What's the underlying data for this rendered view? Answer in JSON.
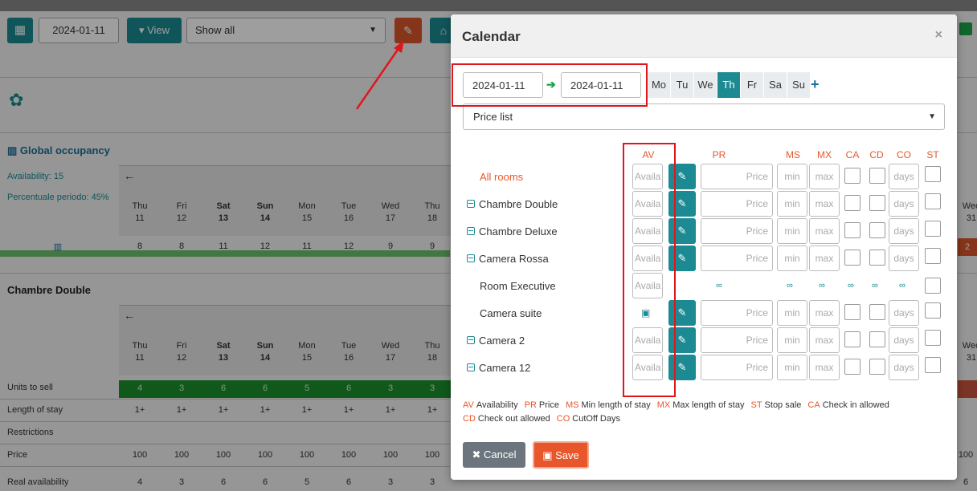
{
  "toolbar": {
    "calendar_icon": "calendar-icon",
    "date": "2024-01-11",
    "view_label": "▾ View",
    "filter_value": "Show all",
    "edit_icon": "edit-icon",
    "gift_icon": "gift-icon"
  },
  "background": {
    "global_title": "Global occupancy",
    "availability": "Availability: 15",
    "percentage": "Percentuale periodo: 45%",
    "days": [
      {
        "dow": "Thu",
        "day": "11",
        "weekend": false
      },
      {
        "dow": "Fri",
        "day": "12",
        "weekend": false
      },
      {
        "dow": "Sat",
        "day": "13",
        "weekend": true
      },
      {
        "dow": "Sun",
        "day": "14",
        "weekend": true
      },
      {
        "dow": "Mon",
        "day": "15",
        "weekend": false
      },
      {
        "dow": "Tue",
        "day": "16",
        "weekend": false
      },
      {
        "dow": "Wed",
        "day": "17",
        "weekend": false
      },
      {
        "dow": "Thu",
        "day": "18",
        "weekend": false
      }
    ],
    "right_day": {
      "dow": "Wed",
      "day": "31"
    },
    "occupancy": [
      "8",
      "8",
      "11",
      "12",
      "11",
      "12",
      "9",
      "9"
    ],
    "right_occupancy": "2",
    "section_title": "Chambre Double",
    "row_labels": [
      "Units to sell",
      "Length of stay",
      "Restrictions",
      "Price",
      "Real availability"
    ],
    "units_to_sell": [
      "4",
      "3",
      "6",
      "6",
      "5",
      "6",
      "3",
      "3"
    ],
    "length_of_stay": [
      "1+",
      "1+",
      "1+",
      "1+",
      "1+",
      "1+",
      "1+",
      "1+"
    ],
    "price": [
      "100",
      "100",
      "100",
      "100",
      "100",
      "100",
      "100",
      "100"
    ],
    "real_availability": [
      "4",
      "3",
      "6",
      "6",
      "5",
      "6",
      "3",
      "3"
    ],
    "right_edge_extra": {
      "price": "100",
      "real_availability": "6"
    }
  },
  "modal": {
    "title": "Calendar",
    "close": "×",
    "date_from": "2024-01-11",
    "date_to": "2024-01-11",
    "weekdays": [
      {
        "label": "Mo",
        "active": false
      },
      {
        "label": "Tu",
        "active": false
      },
      {
        "label": "We",
        "active": false
      },
      {
        "label": "Th",
        "active": true
      },
      {
        "label": "Fr",
        "active": false
      },
      {
        "label": "Sa",
        "active": false
      },
      {
        "label": "Su",
        "active": false
      }
    ],
    "add": "+",
    "pricelist": "Price list",
    "columns": {
      "av": "AV",
      "pr": "PR",
      "ms": "MS",
      "mx": "MX",
      "ca": "CA",
      "cd": "CD",
      "co": "CO",
      "st": "ST"
    },
    "placeholders": {
      "av": "Availa",
      "price": "Price",
      "min": "min",
      "max": "max",
      "days": "days"
    },
    "rooms": [
      {
        "name": "All rooms",
        "kind": "all"
      },
      {
        "name": "Chambre Double",
        "kind": "group"
      },
      {
        "name": "Chambre Deluxe",
        "kind": "group"
      },
      {
        "name": "Camera Rossa",
        "kind": "group"
      },
      {
        "name": "Room Executive",
        "kind": "linked"
      },
      {
        "name": "Camera suite",
        "kind": "suite"
      },
      {
        "name": "Camera 2",
        "kind": "group"
      },
      {
        "name": "Camera 12",
        "kind": "group"
      }
    ],
    "legend": [
      {
        "key": "AV",
        "text": "Availability"
      },
      {
        "key": "PR",
        "text": "Price"
      },
      {
        "key": "MS",
        "text": "Min length of stay"
      },
      {
        "key": "MX",
        "text": "Max length of stay"
      },
      {
        "key": "ST",
        "text": "Stop sale"
      },
      {
        "key": "CA",
        "text": "Check in allowed"
      },
      {
        "key": "CD",
        "text": "Check out allowed"
      },
      {
        "key": "CO",
        "text": "CutOff Days"
      }
    ],
    "cancel_label": "Cancel",
    "save_label": "Save"
  }
}
